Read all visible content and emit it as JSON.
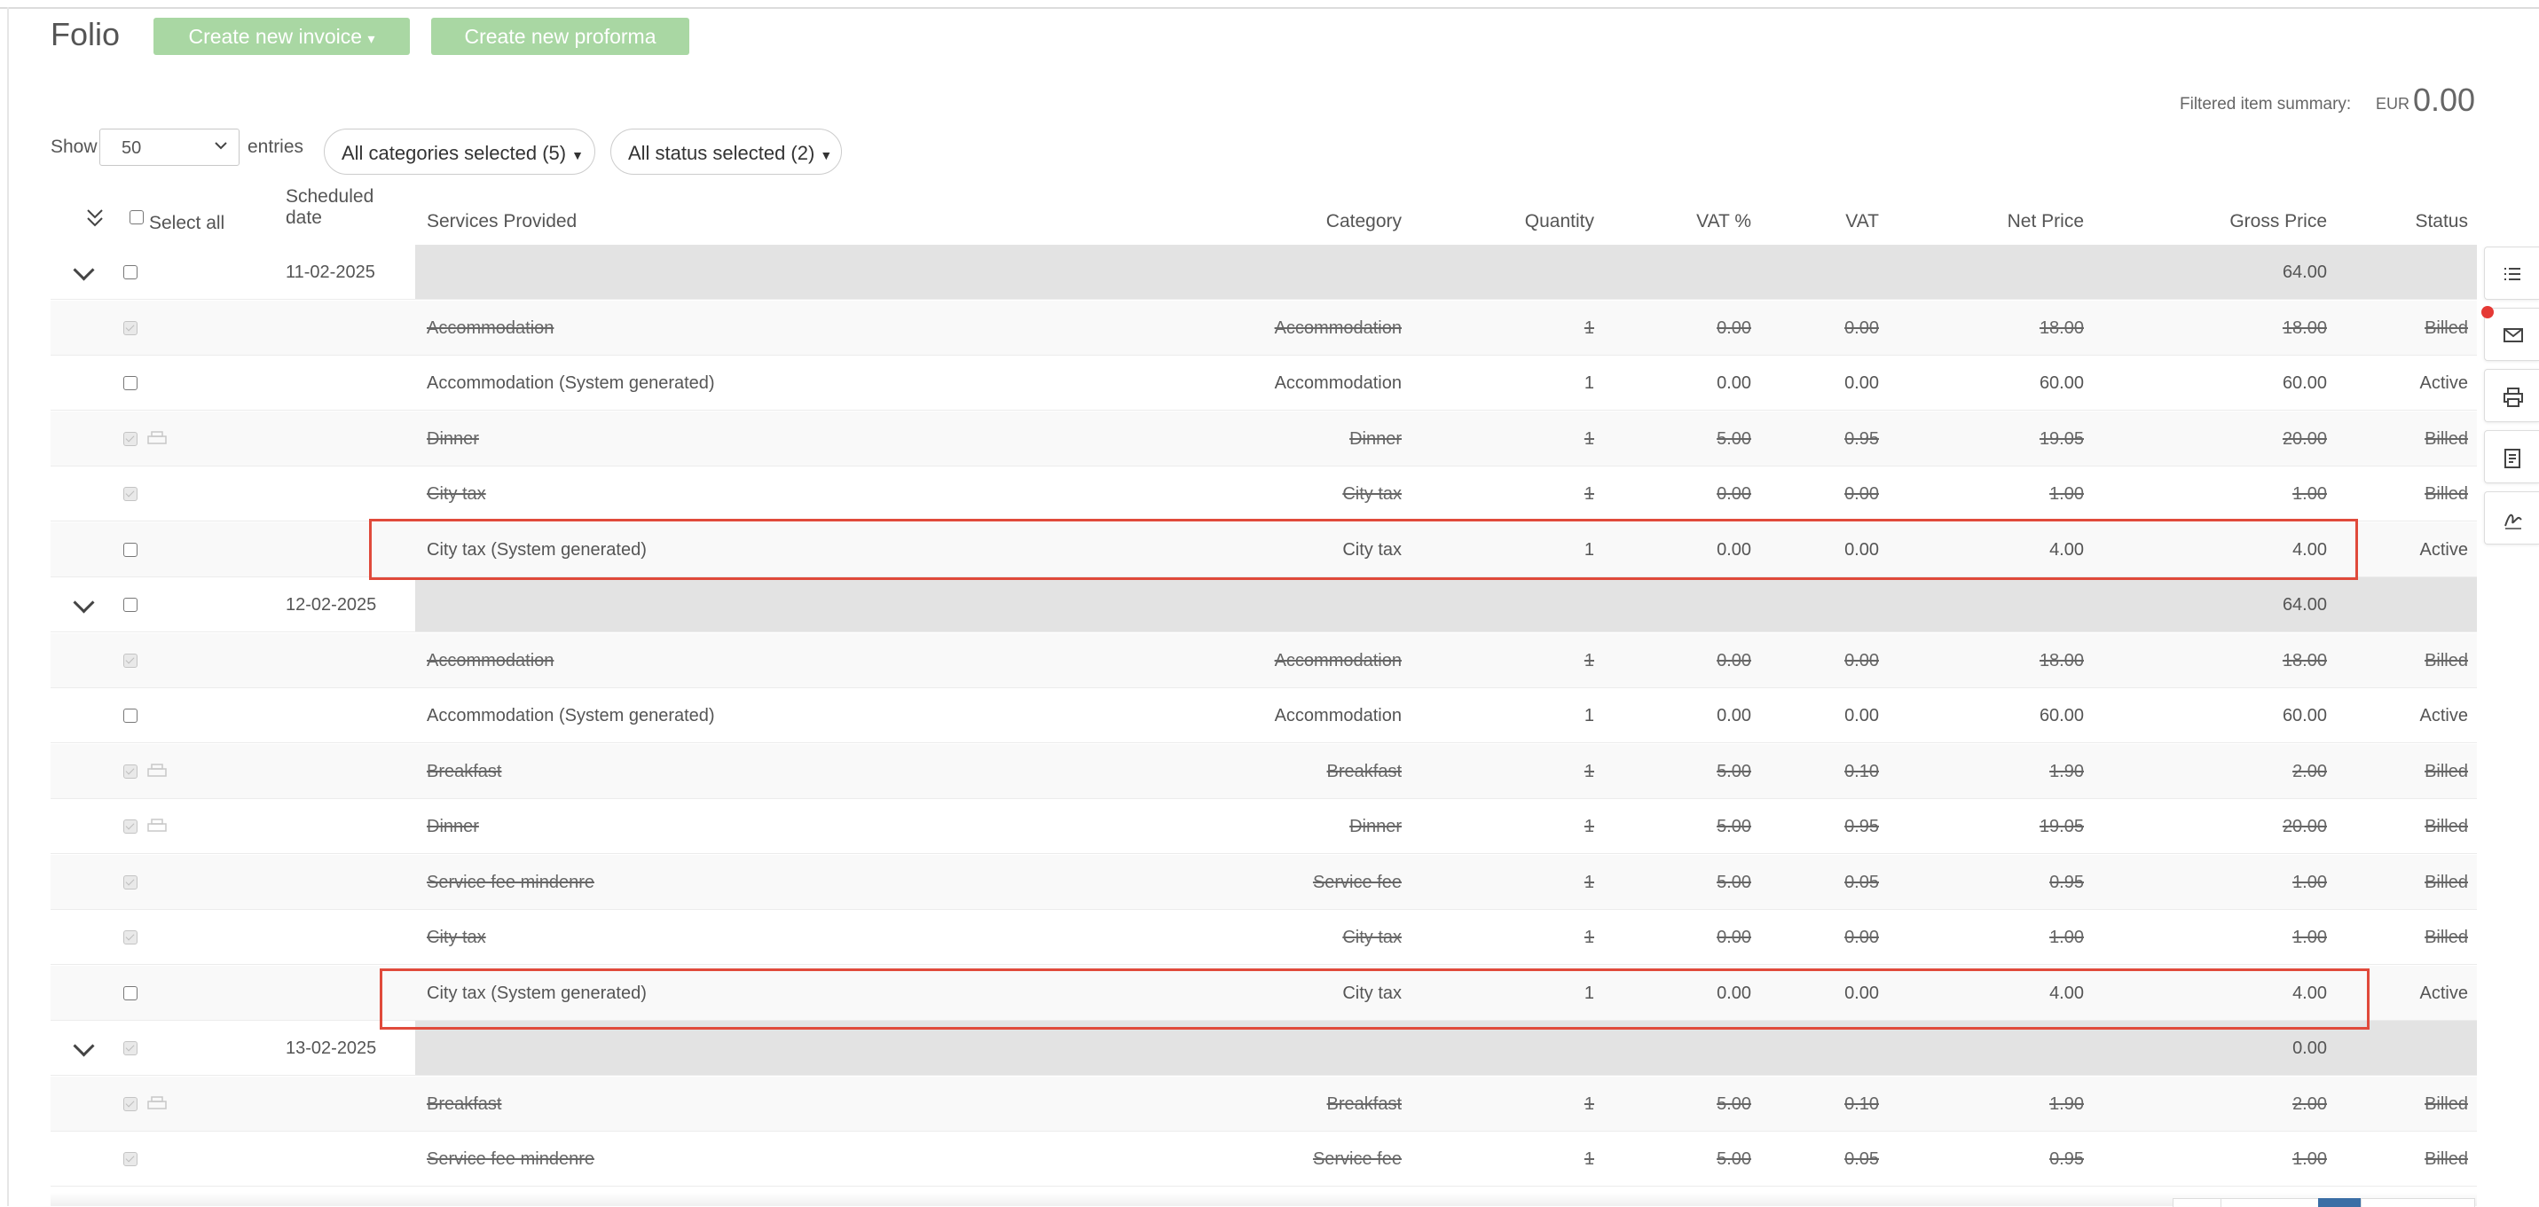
{
  "header": {
    "title": "Folio",
    "create_invoice": "Create new invoice",
    "create_invoice_caret": "▾",
    "create_proforma": "Create new proforma"
  },
  "summary": {
    "label": "Filtered item summary:",
    "currency": "EUR",
    "value": "0.00"
  },
  "controls": {
    "show_label": "Show",
    "entries_value": "50",
    "entries_label": "entries",
    "categories_filter": "All categories selected (5)",
    "status_filter": "All status selected (2)"
  },
  "columns": {
    "select_all": "Select all",
    "scheduled_line1": "Scheduled",
    "scheduled_line2": "date",
    "services": "Services Provided",
    "category": "Category",
    "quantity": "Quantity",
    "vat_pct": "VAT %",
    "vat": "VAT",
    "net": "Net Price",
    "gross": "Gross Price",
    "status": "Status"
  },
  "rows": [
    {
      "kind": "group",
      "date": "11-02-2025",
      "total": "64.00"
    },
    {
      "kind": "item",
      "billed": true,
      "printer": false,
      "service": "Accommodation",
      "category": "Accommodation",
      "qty": "1",
      "vatp": "0.00",
      "vat": "0.00",
      "net": "18.00",
      "gross": "18.00",
      "status": "Billed"
    },
    {
      "kind": "item",
      "billed": false,
      "printer": false,
      "service": "Accommodation (System generated)",
      "category": "Accommodation",
      "qty": "1",
      "vatp": "0.00",
      "vat": "0.00",
      "net": "60.00",
      "gross": "60.00",
      "status": "Active"
    },
    {
      "kind": "item",
      "billed": true,
      "printer": true,
      "service": "Dinner",
      "category": "Dinner",
      "qty": "1",
      "vatp": "5.00",
      "vat": "0.95",
      "net": "19.05",
      "gross": "20.00",
      "status": "Billed"
    },
    {
      "kind": "item",
      "billed": true,
      "printer": false,
      "service": "City tax",
      "category": "City tax",
      "qty": "1",
      "vatp": "0.00",
      "vat": "0.00",
      "net": "1.00",
      "gross": "1.00",
      "status": "Billed"
    },
    {
      "kind": "item",
      "billed": false,
      "printer": false,
      "service": "City tax (System generated)",
      "category": "City tax",
      "qty": "1",
      "vatp": "0.00",
      "vat": "0.00",
      "net": "4.00",
      "gross": "4.00",
      "status": "Active"
    },
    {
      "kind": "group",
      "date": "12-02-2025",
      "total": "64.00"
    },
    {
      "kind": "item",
      "billed": true,
      "printer": false,
      "service": "Accommodation",
      "category": "Accommodation",
      "qty": "1",
      "vatp": "0.00",
      "vat": "0.00",
      "net": "18.00",
      "gross": "18.00",
      "status": "Billed"
    },
    {
      "kind": "item",
      "billed": false,
      "printer": false,
      "service": "Accommodation (System generated)",
      "category": "Accommodation",
      "qty": "1",
      "vatp": "0.00",
      "vat": "0.00",
      "net": "60.00",
      "gross": "60.00",
      "status": "Active"
    },
    {
      "kind": "item",
      "billed": true,
      "printer": true,
      "service": "Breakfast",
      "category": "Breakfast",
      "qty": "1",
      "vatp": "5.00",
      "vat": "0.10",
      "net": "1.90",
      "gross": "2.00",
      "status": "Billed"
    },
    {
      "kind": "item",
      "billed": true,
      "printer": true,
      "service": "Dinner",
      "category": "Dinner",
      "qty": "1",
      "vatp": "5.00",
      "vat": "0.95",
      "net": "19.05",
      "gross": "20.00",
      "status": "Billed"
    },
    {
      "kind": "item",
      "billed": true,
      "printer": false,
      "service": "Service fee mindenre",
      "category": "Service fee",
      "qty": "1",
      "vatp": "5.00",
      "vat": "0.05",
      "net": "0.95",
      "gross": "1.00",
      "status": "Billed"
    },
    {
      "kind": "item",
      "billed": true,
      "printer": false,
      "service": "City tax",
      "category": "City tax",
      "qty": "1",
      "vatp": "0.00",
      "vat": "0.00",
      "net": "1.00",
      "gross": "1.00",
      "status": "Billed"
    },
    {
      "kind": "item",
      "billed": false,
      "printer": false,
      "service": "City tax (System generated)",
      "category": "City tax",
      "qty": "1",
      "vatp": "0.00",
      "vat": "0.00",
      "net": "4.00",
      "gross": "4.00",
      "status": "Active"
    },
    {
      "kind": "group",
      "date": "13-02-2025",
      "total": "0.00",
      "disabled": true
    },
    {
      "kind": "item",
      "billed": true,
      "printer": true,
      "service": "Breakfast",
      "category": "Breakfast",
      "qty": "1",
      "vatp": "5.00",
      "vat": "0.10",
      "net": "1.90",
      "gross": "2.00",
      "status": "Billed"
    },
    {
      "kind": "item",
      "billed": true,
      "printer": false,
      "service": "Service fee mindenre",
      "category": "Service fee",
      "qty": "1",
      "vatp": "5.00",
      "vat": "0.05",
      "net": "0.95",
      "gross": "1.00",
      "status": "Billed"
    }
  ],
  "side_toolbar": [
    "list-icon",
    "envelope-icon",
    "printer-icon",
    "document-icon",
    "signature-icon"
  ],
  "colors": {
    "button_green": "#a9d7a3",
    "highlight": "#e04a3b",
    "group_bar": "#e3e3e3",
    "notification": "#e53935"
  }
}
